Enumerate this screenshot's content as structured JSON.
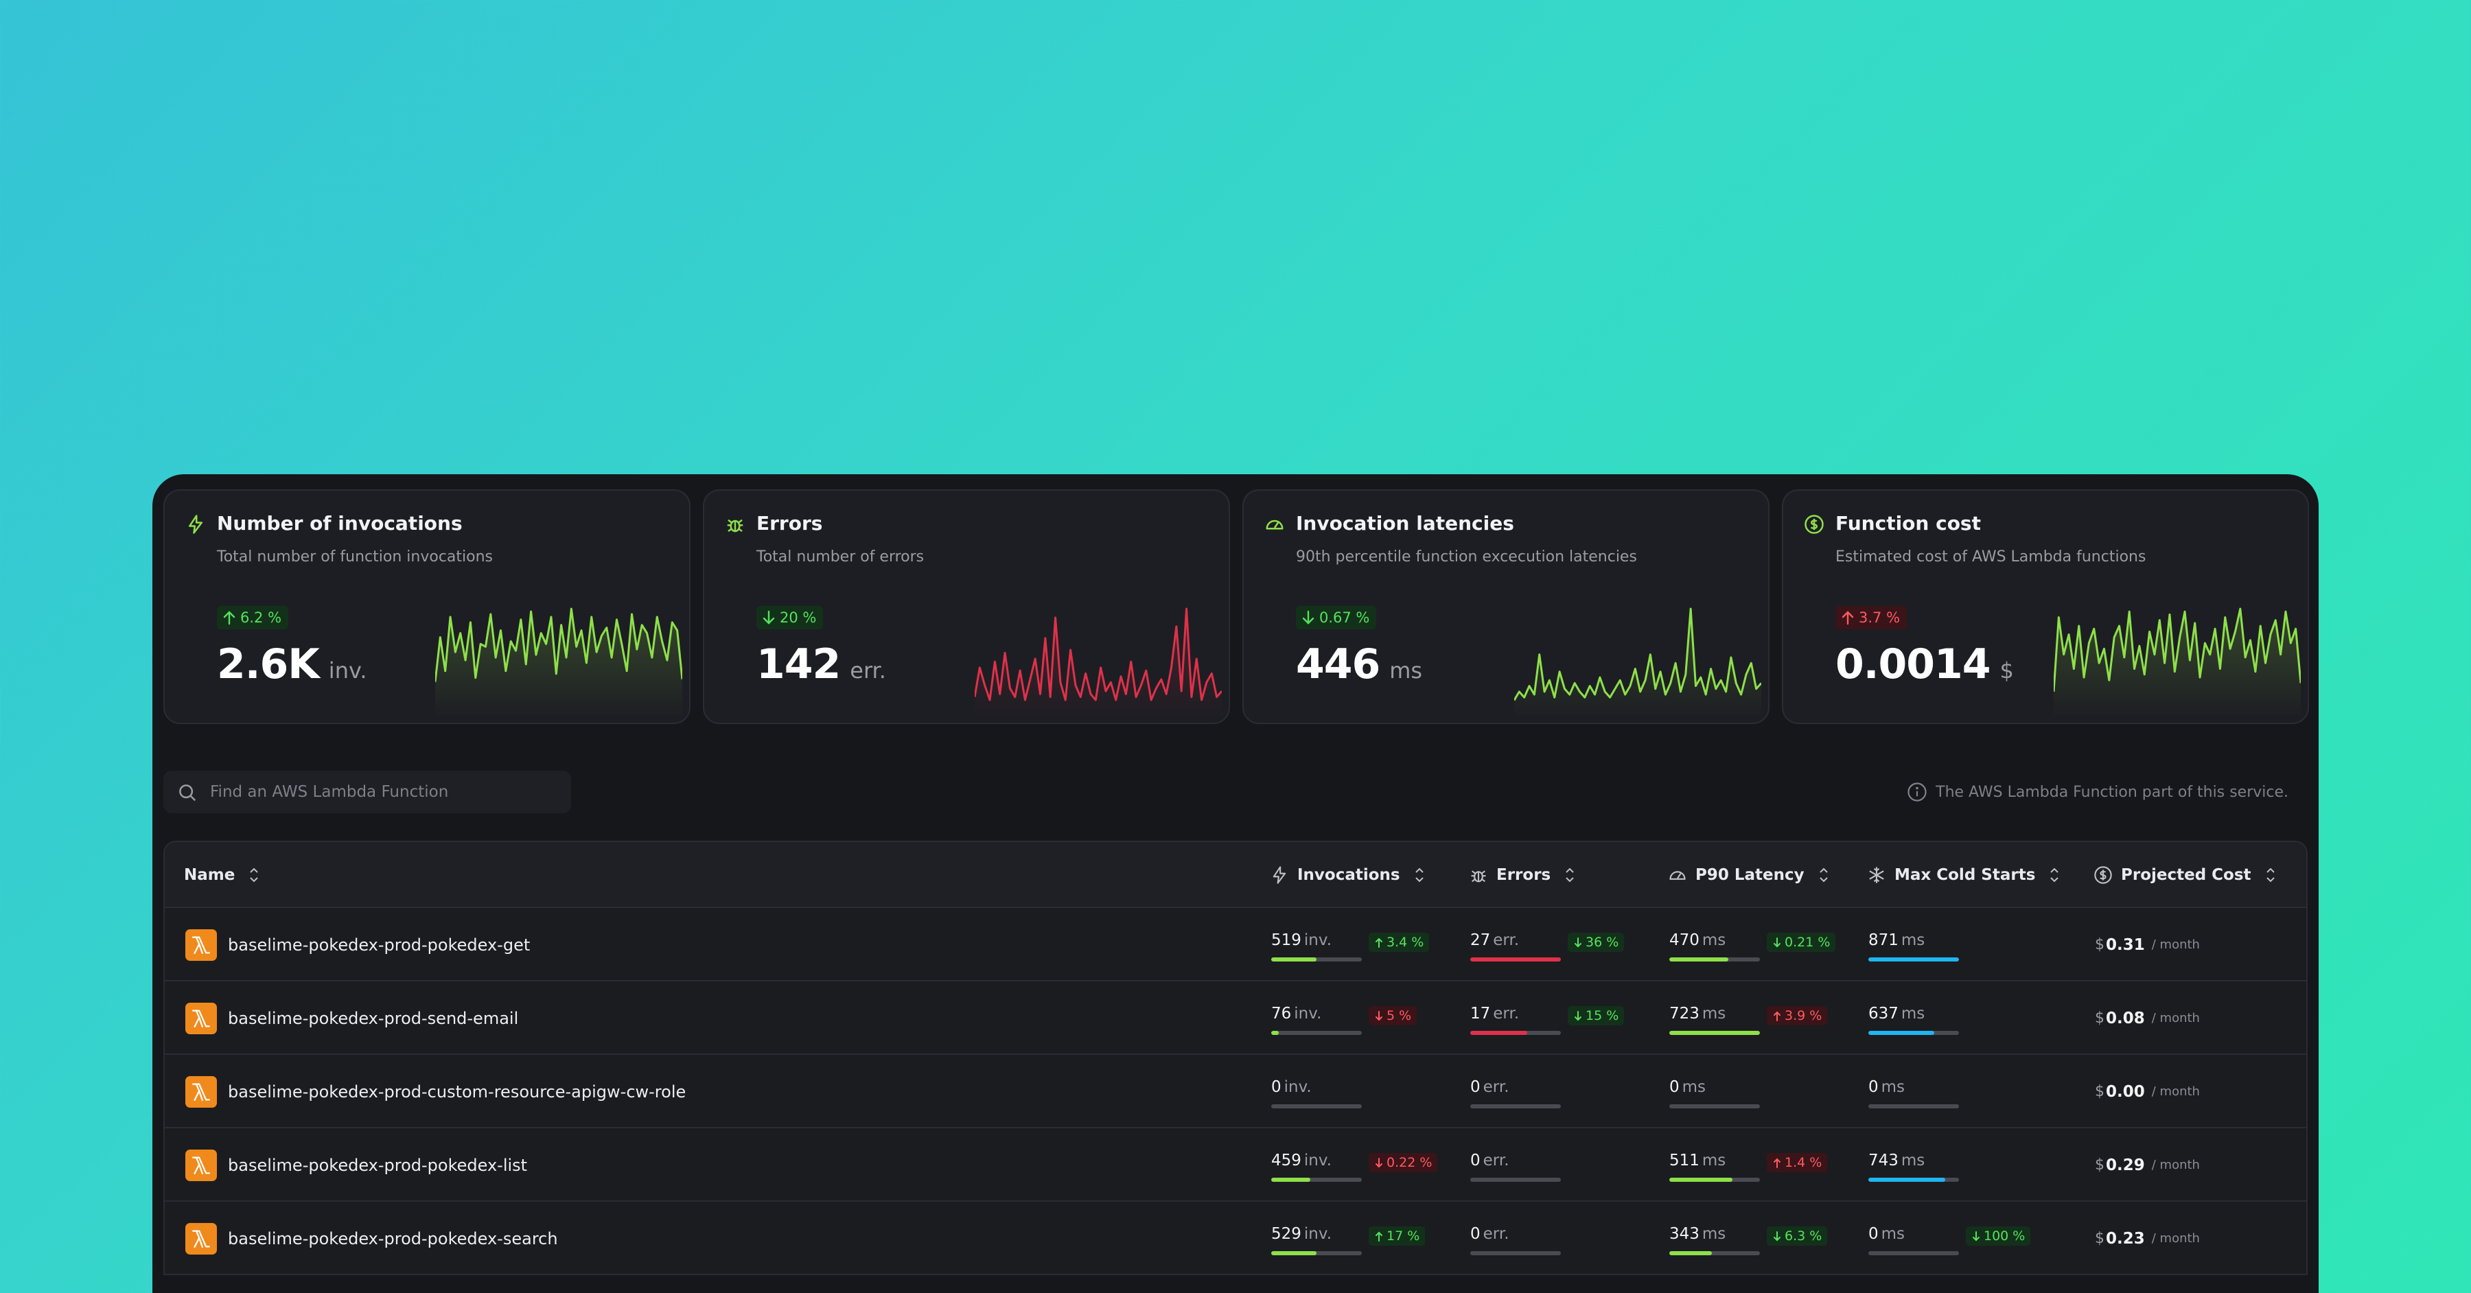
{
  "cards": [
    {
      "title": "Number of invocations",
      "subtitle": "Total number of function invocations",
      "delta": "6.2 %",
      "delta_direction": "up",
      "value": "2.6K",
      "unit": "inv.",
      "icon": "bolt-icon",
      "color": "#8ee04a",
      "series": [
        22,
        55,
        30,
        70,
        44,
        58,
        38,
        66,
        25,
        50,
        48,
        72,
        40,
        60,
        30,
        52,
        45,
        68,
        35,
        74,
        42,
        58,
        50,
        70,
        28,
        64,
        40,
        76,
        48,
        60,
        36,
        70,
        44,
        56,
        62,
        40,
        68,
        50,
        30,
        72,
        46,
        64,
        58,
        40,
        70,
        52,
        38,
        66,
        60,
        24
      ]
    },
    {
      "title": "Errors",
      "subtitle": "Total number of errors",
      "delta": "20 %",
      "delta_direction": "down",
      "value": "142",
      "unit": "err.",
      "icon": "bug-icon",
      "color": "#e0314a",
      "series": [
        10,
        30,
        18,
        8,
        34,
        12,
        40,
        16,
        10,
        28,
        8,
        22,
        36,
        12,
        50,
        10,
        64,
        20,
        8,
        42,
        18,
        10,
        26,
        12,
        8,
        30,
        14,
        20,
        8,
        24,
        12,
        34,
        10,
        18,
        28,
        8,
        16,
        22,
        12,
        30,
        58,
        14,
        70,
        10,
        36,
        8,
        20,
        26,
        10,
        14
      ]
    },
    {
      "title": "Invocation latencies",
      "subtitle": "90th percentile function excecution latencies",
      "delta": "0.67 %",
      "delta_direction": "down",
      "value": "446",
      "unit": "ms",
      "icon": "gauge-icon",
      "color": "#8ee04a",
      "series": [
        8,
        14,
        10,
        18,
        12,
        40,
        14,
        22,
        10,
        28,
        16,
        12,
        20,
        14,
        10,
        18,
        12,
        24,
        14,
        10,
        16,
        22,
        12,
        18,
        30,
        14,
        22,
        40,
        16,
        28,
        12,
        20,
        34,
        14,
        26,
        72,
        18,
        24,
        12,
        30,
        16,
        22,
        14,
        38,
        20,
        12,
        26,
        34,
        16,
        20
      ]
    },
    {
      "title": "Function cost",
      "subtitle": "Estimated cost of AWS Lambda functions",
      "delta": "3.7 %",
      "delta_direction": "up",
      "value": "0.0014",
      "unit": "$",
      "icon": "dollar-circle-icon",
      "color": "#8ee04a",
      "series": [
        14,
        66,
        40,
        54,
        30,
        60,
        24,
        48,
        58,
        34,
        44,
        22,
        52,
        60,
        38,
        70,
        30,
        46,
        26,
        56,
        40,
        64,
        34,
        68,
        28,
        52,
        70,
        36,
        62,
        24,
        48,
        40,
        58,
        30,
        66,
        44,
        56,
        72,
        38,
        50,
        28,
        60,
        34,
        54,
        64,
        40,
        70,
        48,
        58,
        20
      ]
    }
  ],
  "search": {
    "placeholder": "Find an AWS Lambda Function"
  },
  "info_text": "The AWS Lambda Function part of this service.",
  "columns": {
    "name": "Name",
    "invocations": "Invocations",
    "errors": "Errors",
    "latency": "P90 Latency",
    "cold_starts": "Max Cold Starts",
    "cost": "Projected Cost"
  },
  "colors": {
    "invocations_bar": "#8ee04a",
    "errors_bar": "#e0314a",
    "latency_bar": "#8ee04a",
    "cold_bar": "#1fb6f0"
  },
  "rows": [
    {
      "name": "baselime-pokedex-prod-pokedex-get",
      "invocations": {
        "value": "519",
        "unit": "inv.",
        "fill": 0.5,
        "delta": "3.4 %",
        "dir": "up",
        "good": true
      },
      "errors": {
        "value": "27",
        "unit": "err.",
        "fill": 1.0,
        "delta": "36 %",
        "dir": "down",
        "good": true
      },
      "latency": {
        "value": "470",
        "unit": "ms",
        "fill": 0.65,
        "delta": "0.21 %",
        "dir": "down",
        "good": true
      },
      "cold": {
        "value": "871",
        "unit": "ms",
        "fill": 1.0,
        "delta": "",
        "dir": "",
        "good": true
      },
      "cost": {
        "currency": "$",
        "value": "0.31",
        "per": "/ month"
      }
    },
    {
      "name": "baselime-pokedex-prod-send-email",
      "invocations": {
        "value": "76",
        "unit": "inv.",
        "fill": 0.08,
        "delta": "5 %",
        "dir": "down",
        "good": false
      },
      "errors": {
        "value": "17",
        "unit": "err.",
        "fill": 0.63,
        "delta": "15 %",
        "dir": "down",
        "good": true
      },
      "latency": {
        "value": "723",
        "unit": "ms",
        "fill": 1.0,
        "delta": "3.9 %",
        "dir": "up",
        "good": false
      },
      "cold": {
        "value": "637",
        "unit": "ms",
        "fill": 0.73,
        "delta": "",
        "dir": "",
        "good": true
      },
      "cost": {
        "currency": "$",
        "value": "0.08",
        "per": "/ month"
      }
    },
    {
      "name": "baselime-pokedex-prod-custom-resource-apigw-cw-role",
      "invocations": {
        "value": "0",
        "unit": "inv.",
        "fill": 0,
        "delta": "",
        "dir": "",
        "good": true
      },
      "errors": {
        "value": "0",
        "unit": "err.",
        "fill": 0,
        "delta": "",
        "dir": "",
        "good": true
      },
      "latency": {
        "value": "0",
        "unit": "ms",
        "fill": 0,
        "delta": "",
        "dir": "",
        "good": true
      },
      "cold": {
        "value": "0",
        "unit": "ms",
        "fill": 0,
        "delta": "",
        "dir": "",
        "good": true
      },
      "cost": {
        "currency": "$",
        "value": "0.00",
        "per": "/ month"
      }
    },
    {
      "name": "baselime-pokedex-prod-pokedex-list",
      "invocations": {
        "value": "459",
        "unit": "inv.",
        "fill": 0.43,
        "delta": "0.22 %",
        "dir": "down",
        "good": false
      },
      "errors": {
        "value": "0",
        "unit": "err.",
        "fill": 0,
        "delta": "",
        "dir": "",
        "good": true
      },
      "latency": {
        "value": "511",
        "unit": "ms",
        "fill": 0.7,
        "delta": "1.4 %",
        "dir": "up",
        "good": false
      },
      "cold": {
        "value": "743",
        "unit": "ms",
        "fill": 0.85,
        "delta": "",
        "dir": "",
        "good": true
      },
      "cost": {
        "currency": "$",
        "value": "0.29",
        "per": "/ month"
      }
    },
    {
      "name": "baselime-pokedex-prod-pokedex-search",
      "invocations": {
        "value": "529",
        "unit": "inv.",
        "fill": 0.5,
        "delta": "17 %",
        "dir": "up",
        "good": true
      },
      "errors": {
        "value": "0",
        "unit": "err.",
        "fill": 0,
        "delta": "",
        "dir": "",
        "good": true
      },
      "latency": {
        "value": "343",
        "unit": "ms",
        "fill": 0.47,
        "delta": "6.3 %",
        "dir": "down",
        "good": true
      },
      "cold": {
        "value": "0",
        "unit": "ms",
        "fill": 0,
        "delta": "100 %",
        "dir": "down",
        "good": true
      },
      "cost": {
        "currency": "$",
        "value": "0.23",
        "per": "/ month"
      }
    }
  ]
}
